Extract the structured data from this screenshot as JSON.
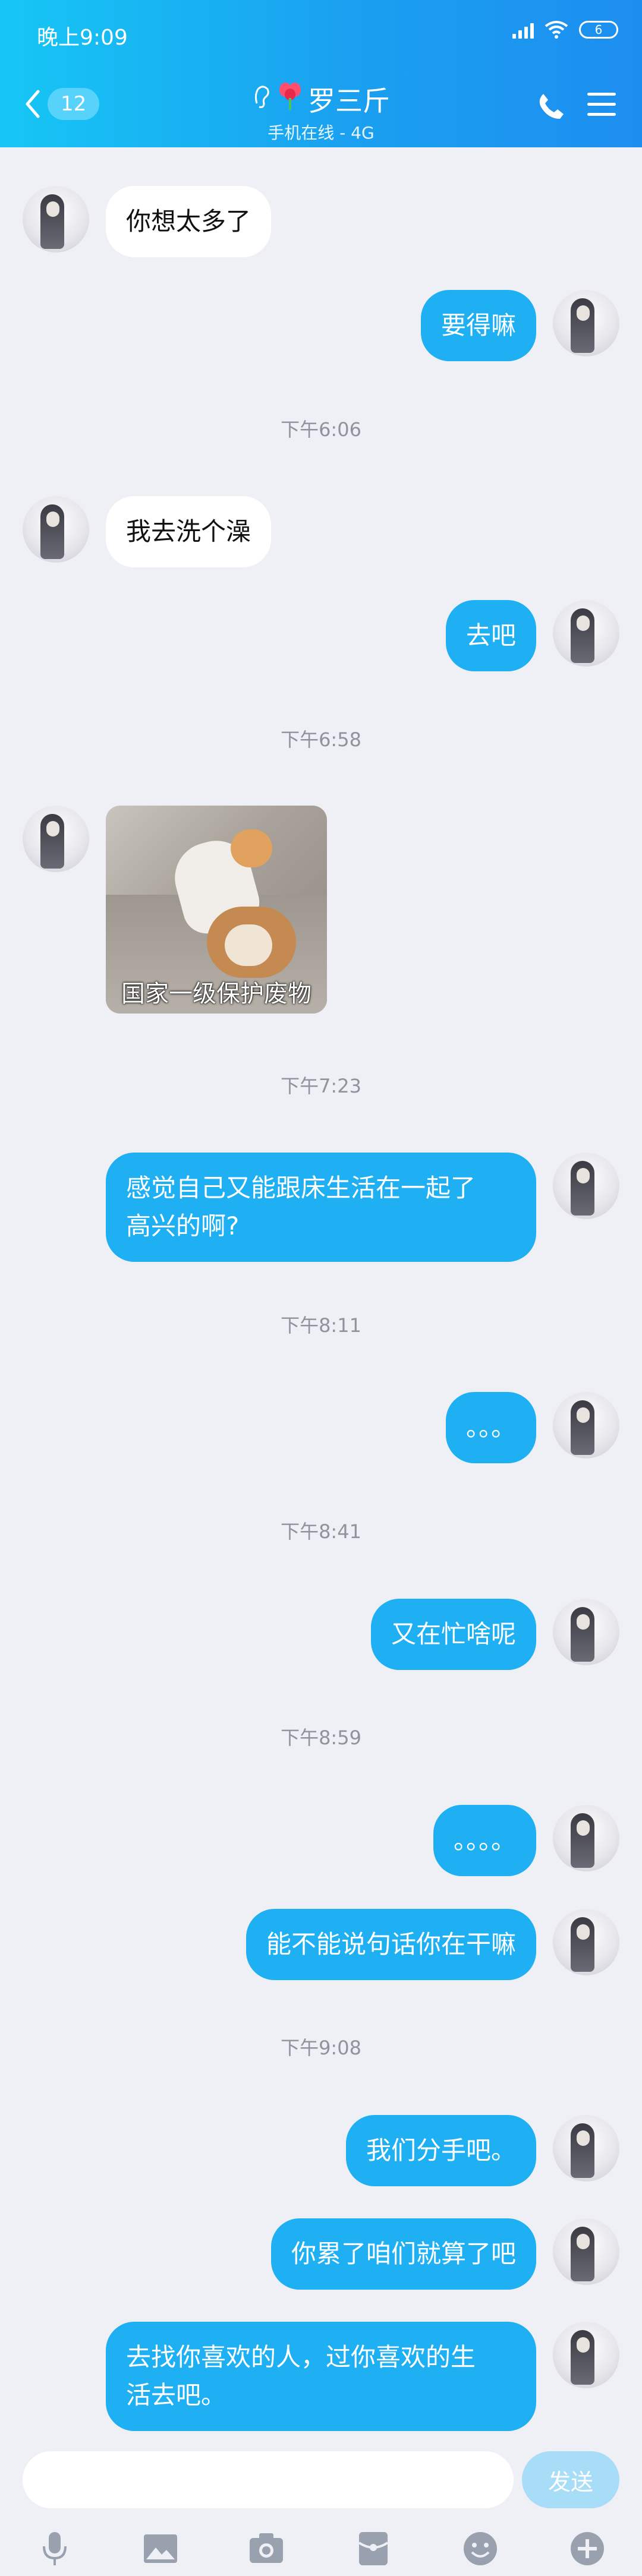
{
  "status_bar": {
    "time": "晚上9:09",
    "battery": "6"
  },
  "header": {
    "unread_count": "12",
    "title": "罗三斤",
    "subtitle": "手机在线 - 4G"
  },
  "messages": [
    {
      "side": "left",
      "text": "你想太多了"
    },
    {
      "side": "right",
      "text": "要得嘛"
    },
    {
      "timestamp": "下午6:06"
    },
    {
      "side": "left",
      "text": "我去洗个澡"
    },
    {
      "side": "right",
      "text": "去吧"
    },
    {
      "timestamp": "下午6:58"
    },
    {
      "side": "left",
      "sticker_caption": "国家一级保护废物"
    },
    {
      "timestamp": "下午7:23"
    },
    {
      "side": "right",
      "text_line1": "感觉自己又能跟床生活在一起了",
      "text_line2": "高兴的啊?"
    },
    {
      "timestamp": "下午8:11"
    },
    {
      "side": "right",
      "text": "。。。"
    },
    {
      "timestamp": "下午8:41"
    },
    {
      "side": "right",
      "text": "又在忙啥呢"
    },
    {
      "timestamp": "下午8:59"
    },
    {
      "side": "right",
      "text": "。。。。"
    },
    {
      "side": "right",
      "text": "能不能说句话你在干嘛"
    },
    {
      "timestamp": "下午9:08"
    },
    {
      "side": "right",
      "text": "我们分手吧。"
    },
    {
      "side": "right",
      "text": "你累了咱们就算了吧"
    },
    {
      "side": "right",
      "text_line1": "去找你喜欢的人，过你喜欢的生",
      "text_line2": "活去吧。"
    }
  ],
  "input": {
    "value": "",
    "send_label": "发送"
  },
  "toolbar": {
    "icons": [
      "microphone-icon",
      "image-icon",
      "camera-icon",
      "red-packet-icon",
      "emoji-icon",
      "plus-icon"
    ]
  },
  "colors": {
    "header_start": "#16c6f5",
    "header_end": "#1d8ef0",
    "bubble_right": "#1eb0f3",
    "bubble_left": "#ffffff",
    "background": "#eef0f6",
    "timestamp": "#8e939e",
    "send_button": "#a8ddf8"
  }
}
